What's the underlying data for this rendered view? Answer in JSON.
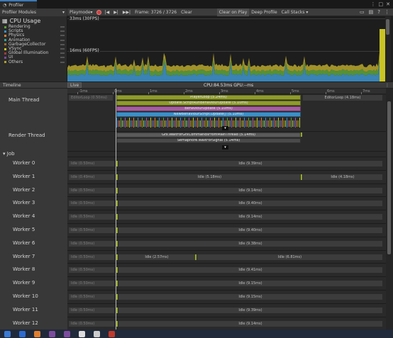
{
  "window": {
    "tab_title": "Profiler"
  },
  "toolbar": {
    "modules_label": "Profiler Modules",
    "playmode_label": "Playmode",
    "frame_label": "Frame: 3726 / 3726",
    "clear_label": "Clear",
    "clear_on_play_label": "Clear on Play",
    "deep_profile_label": "Deep Profile",
    "call_stacks_label": "Call Stacks"
  },
  "cpu_module": {
    "title": "CPU Usage",
    "legend": [
      {
        "label": "Rendering",
        "color": "#5b9e3c"
      },
      {
        "label": "Scripts",
        "color": "#3d8fc8"
      },
      {
        "label": "Physics",
        "color": "#e07f2e"
      },
      {
        "label": "Animation",
        "color": "#2ba6a0"
      },
      {
        "label": "GarbageCollector",
        "color": "#9c6e2c"
      },
      {
        "label": "VSync",
        "color": "#c9c326"
      },
      {
        "label": "Global Illumination",
        "color": "#a03b3b"
      },
      {
        "label": "UI",
        "color": "#7d4b9e"
      },
      {
        "label": "Others",
        "color": "#b0a02c"
      }
    ],
    "line_30fps": "33ms (30FPS)",
    "line_60fps": "16ms (60FPS)"
  },
  "timeline": {
    "title": "Timeline",
    "live_label": "Live",
    "cpu_gpu": "CPU:84.53ms GPU:--ms",
    "ruler_ticks": [
      "-1ms",
      "0ms",
      "1ms",
      "2ms",
      "3ms",
      "4ms",
      "5ms",
      "6ms",
      "7ms"
    ],
    "main_thread": {
      "label": "Main Thread",
      "editor_loop_left": "EditorLoop (0.50ms)",
      "editor_loop_right": "EditorLoop (4.18ms)",
      "bars": [
        "PlayerLoop (5.24ms)",
        "Update.ScriptRunBehaviourUpdate (5.10ms)",
        "BehaviourUpdate (5.10ms)",
        "NewBehaviourScript.Update() (5.10ms)"
      ]
    },
    "render_thread": {
      "label": "Render Thread",
      "bars": [
        "Gfx.WaitForGfxCommandsFromMainThread (5.14ms)",
        "Semaphore.WaitForSignal (5.14ms)"
      ]
    },
    "job_label": "Job",
    "workers": [
      {
        "name": "Worker 0",
        "left": "Idle (0.50ms)",
        "center": "Idle (9.39ms)",
        "right": ""
      },
      {
        "name": "Worker 1",
        "left": "Idle (0.49ms)",
        "center": "Idle (5.18ms)",
        "right": "Idle (4.18ms)"
      },
      {
        "name": "Worker 2",
        "left": "Idle (0.50ms)",
        "center": "Idle (9.14ms)",
        "right": ""
      },
      {
        "name": "Worker 3",
        "left": "Idle (0.50ms)",
        "center": "Idle (9.40ms)",
        "right": ""
      },
      {
        "name": "Worker 4",
        "left": "Idle (0.50ms)",
        "center": "Idle (9.14ms)",
        "right": ""
      },
      {
        "name": "Worker 5",
        "left": "Idle (0.50ms)",
        "center": "Idle (9.40ms)",
        "right": ""
      },
      {
        "name": "Worker 6",
        "left": "Idle (0.50ms)",
        "center": "Idle (9.38ms)",
        "right": ""
      },
      {
        "name": "Worker 7",
        "left": "Idle (0.50ms)",
        "center": "Idle (2.57ms)",
        "right": "Idle (6.81ms)"
      },
      {
        "name": "Worker 8",
        "left": "Idle (0.50ms)",
        "center": "Idle (9.41ms)",
        "right": ""
      },
      {
        "name": "Worker 9",
        "left": "Idle (0.50ms)",
        "center": "Idle (9.15ms)",
        "right": ""
      },
      {
        "name": "Worker 10",
        "left": "Idle (0.50ms)",
        "center": "Idle (9.15ms)",
        "right": ""
      },
      {
        "name": "Worker 11",
        "left": "Idle (0.50ms)",
        "center": "Idle (9.39ms)",
        "right": ""
      },
      {
        "name": "Worker 12",
        "left": "Idle (0.50ms)",
        "center": "Idle (9.14ms)",
        "right": ""
      }
    ]
  },
  "colors": {
    "playerloop": "#8f9c2a",
    "scripts": "#3d8fc8",
    "update": "#a65da0",
    "render": "#5a5a5a"
  }
}
